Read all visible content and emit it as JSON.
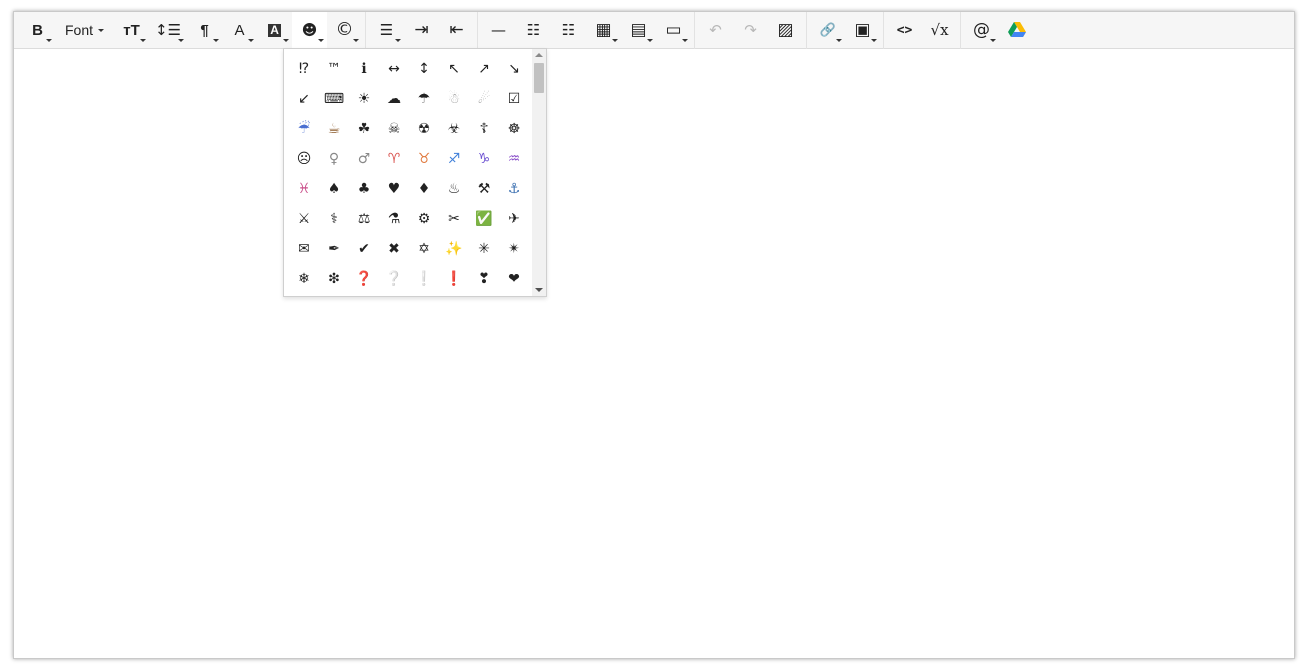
{
  "toolbar": {
    "bold": "B",
    "font_label": "Font",
    "font_size_glyph": "ᴛT",
    "line_height_glyph": "↕☰",
    "paragraph_glyph": "¶",
    "text_color_glyph": "A",
    "bg_color_glyph": "A",
    "emoji_glyph": "☻",
    "special_char_glyph": "©",
    "align_glyph": "☰",
    "indent_glyph": "⇥",
    "outdent_glyph": "⇤",
    "hr_glyph": "—",
    "ul_glyph": "☷",
    "ol_glyph": "☷",
    "table_glyph": "▦",
    "cell_glyph": "▤",
    "table_props_glyph": "▭",
    "undo_glyph": "↶",
    "redo_glyph": "↷",
    "select_all_glyph": "▨",
    "link_glyph": "🔗",
    "image_glyph": "▣",
    "code_glyph": "<>",
    "math_glyph": "√x",
    "mention_glyph": "@"
  },
  "emoji_picker": {
    "rows": [
      [
        "⁉",
        "™",
        "ℹ",
        "↔",
        "↕",
        "↖",
        "↗",
        "↘"
      ],
      [
        "↙",
        "⌨",
        "☀",
        "☁",
        "☂",
        "☃",
        "☄",
        "☑"
      ],
      [
        "☔",
        "☕",
        "☘",
        "☠",
        "☢",
        "☣",
        "☦",
        "☸"
      ],
      [
        "☹",
        "♀",
        "♂",
        "♈",
        "♉",
        "♐",
        "♑",
        "♒"
      ],
      [
        "♓",
        "♠",
        "♣",
        "♥",
        "♦",
        "♨",
        "⚒",
        "⚓"
      ],
      [
        "⚔",
        "⚕",
        "⚖",
        "⚗",
        "⚙",
        "✂",
        "✅",
        "✈"
      ],
      [
        "✉",
        "✒",
        "✔",
        "✖",
        "✡",
        "✨",
        "✳",
        "✴"
      ],
      [
        "❄",
        "❇",
        "❓",
        "❔",
        "❕",
        "❗",
        "❣",
        "❤"
      ]
    ],
    "colors": {
      "☔": "#4a6fd1",
      "☕": "#8b5a2b",
      "♈": "#d9534f",
      "♉": "#e07a3f",
      "♐": "#3f7fd9",
      "♑": "#6b4fd1",
      "♒": "#8a4fc9",
      "♓": "#c94f8a",
      "⚓": "#3a6fb0",
      "✅": "#2e9e3e",
      "✨": "#e6b800",
      "❓": "#d9534f",
      "❔": "#bdbdbd",
      "❕": "#bdbdbd",
      "❗": "#d9302f",
      "♀": "#888888",
      "♂": "#888888",
      "☃": "#aaaaaa",
      "☄": "#aaaaaa"
    }
  }
}
